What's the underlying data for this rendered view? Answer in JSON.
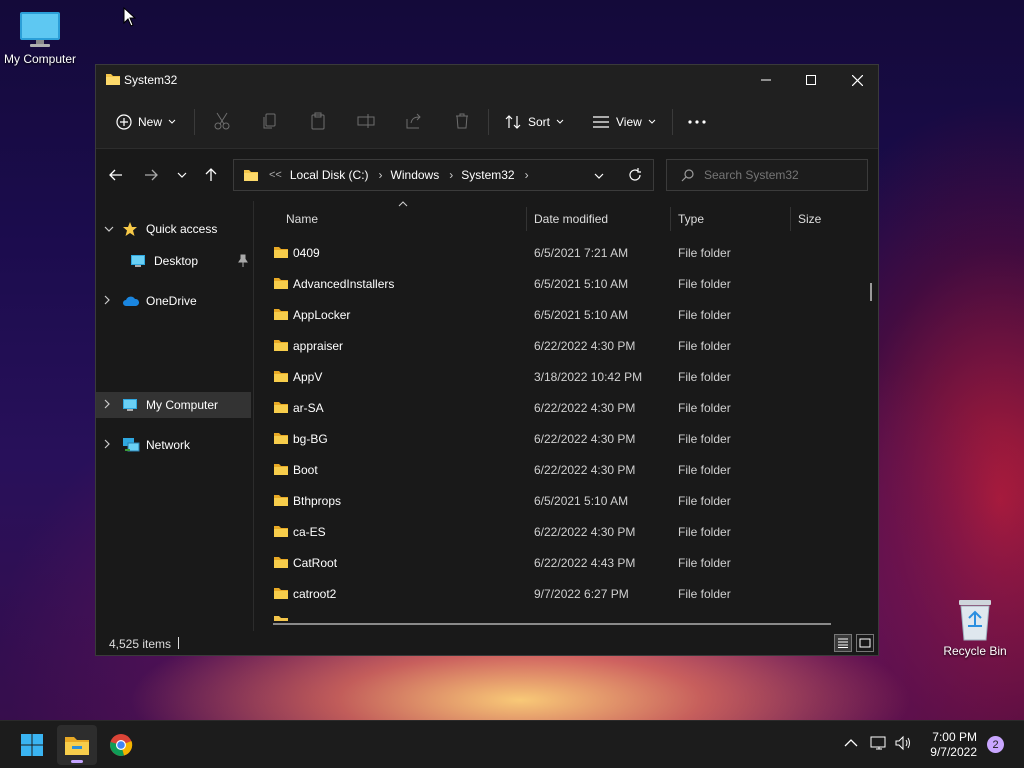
{
  "desktop": {
    "icons": [
      {
        "label": "My Computer"
      },
      {
        "label": "Recycle Bin"
      }
    ]
  },
  "window": {
    "title": "System32",
    "toolbar": {
      "new_label": "New",
      "sort_label": "Sort",
      "view_label": "View"
    },
    "address": {
      "overflow": "<<",
      "crumbs": [
        "Local Disk (C:)",
        "Windows",
        "System32"
      ]
    },
    "search": {
      "placeholder": "Search System32"
    },
    "sidebar": {
      "items": [
        {
          "label": "Quick access"
        },
        {
          "label": "Desktop"
        },
        {
          "label": "OneDrive"
        },
        {
          "label": "My Computer"
        },
        {
          "label": "Network"
        }
      ]
    },
    "columns": {
      "name": "Name",
      "date": "Date modified",
      "type": "Type",
      "size": "Size"
    },
    "rows": [
      {
        "name": "0409",
        "date": "6/5/2021 7:21 AM",
        "type": "File folder"
      },
      {
        "name": "AdvancedInstallers",
        "date": "6/5/2021 5:10 AM",
        "type": "File folder"
      },
      {
        "name": "AppLocker",
        "date": "6/5/2021 5:10 AM",
        "type": "File folder"
      },
      {
        "name": "appraiser",
        "date": "6/22/2022 4:30 PM",
        "type": "File folder"
      },
      {
        "name": "AppV",
        "date": "3/18/2022 10:42 PM",
        "type": "File folder"
      },
      {
        "name": "ar-SA",
        "date": "6/22/2022 4:30 PM",
        "type": "File folder"
      },
      {
        "name": "bg-BG",
        "date": "6/22/2022 4:30 PM",
        "type": "File folder"
      },
      {
        "name": "Boot",
        "date": "6/22/2022 4:30 PM",
        "type": "File folder"
      },
      {
        "name": "Bthprops",
        "date": "6/5/2021 5:10 AM",
        "type": "File folder"
      },
      {
        "name": "ca-ES",
        "date": "6/22/2022 4:30 PM",
        "type": "File folder"
      },
      {
        "name": "CatRoot",
        "date": "6/22/2022 4:43 PM",
        "type": "File folder"
      },
      {
        "name": "catroot2",
        "date": "9/7/2022 6:27 PM",
        "type": "File folder"
      }
    ],
    "status": {
      "item_count": "4,525 items"
    }
  },
  "taskbar": {
    "time": "7:00 PM",
    "date": "9/7/2022",
    "notification_count": "2"
  },
  "colors": {
    "folder": "#f3c54a",
    "accent": "#4cc2ff"
  }
}
